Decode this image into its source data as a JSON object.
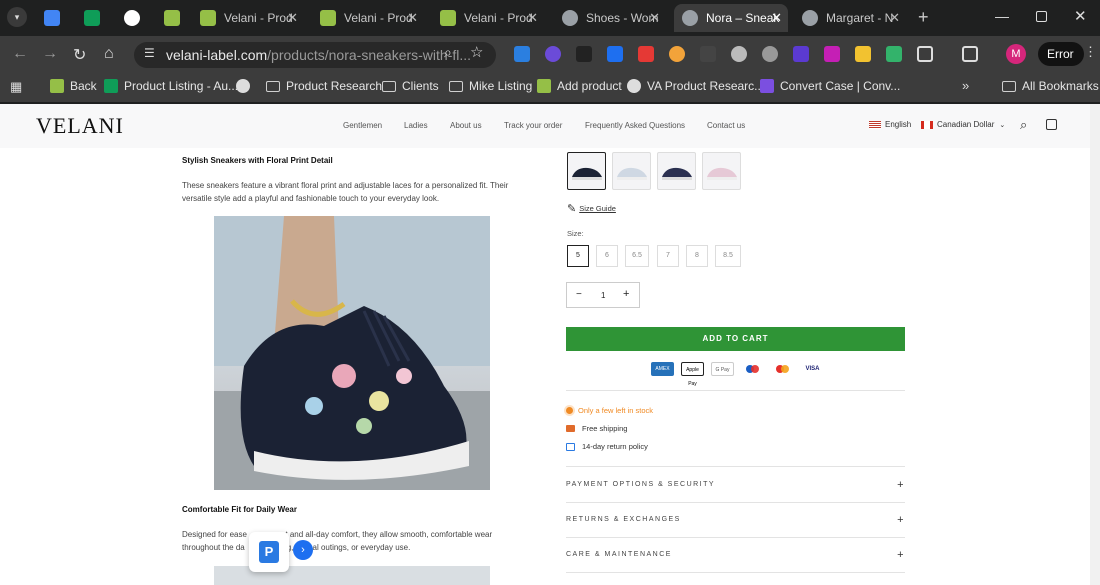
{
  "browser": {
    "tabs": [
      {
        "label": "",
        "icon": "google-docs-icon",
        "color": "#4285f4"
      },
      {
        "label": "",
        "icon": "google-sheets-icon",
        "color": "#0f9d58"
      },
      {
        "label": "",
        "icon": "google-icon",
        "color": "#ffffff"
      },
      {
        "label": "",
        "icon": "shopify-icon",
        "color": "#95bf47"
      },
      {
        "label": "Velani - Prod",
        "icon": "shopify-icon",
        "color": "#95bf47"
      },
      {
        "label": "Velani - Prod",
        "icon": "shopify-icon",
        "color": "#95bf47"
      },
      {
        "label": "Velani - Prod",
        "icon": "shopify-icon",
        "color": "#95bf47"
      },
      {
        "label": "Shoes - Wom",
        "icon": "globe-icon",
        "color": "#9aa0a6"
      },
      {
        "label": "Nora – Sneak",
        "icon": "globe-icon",
        "color": "#9aa0a6"
      },
      {
        "label": "Margaret - N",
        "icon": "globe-icon",
        "color": "#9aa0a6"
      }
    ],
    "url_host": "velani-label.com",
    "url_path": "/products/nora-sneakers-with-fl...",
    "error_label": "Error",
    "profile_initial": "M",
    "bookmarks": [
      "Back",
      "Product Listing - Au...",
      "",
      "Product Research",
      "Clients",
      "Mike Listing",
      "Add product",
      "VA Product Researc...",
      "Convert Case | Conv..."
    ],
    "all_bookmarks": "All Bookmarks"
  },
  "site": {
    "logo": "VELANI",
    "nav": [
      "Gentlemen",
      "Ladies",
      "About us",
      "Track your order",
      "Frequently Asked Questions",
      "Contact us"
    ],
    "language": "English",
    "currency": "Canadian Dollar"
  },
  "description": {
    "heading1": "Stylish Sneakers with Floral Print Detail",
    "para1": "These sneakers feature a vibrant floral print and adjustable laces for a personalized fit. Their versatile style add a playful and fashionable touch to your everyday look.",
    "heading2": "Comfortable Fit for Daily Wear",
    "para2_a": "Designed for ease",
    "para2_b": "nt and all-day comfort, they allow smooth, comfortable wear",
    "para2_c": "throughout the da",
    "para2_d": "g, casual outings, or everyday use."
  },
  "product": {
    "size_guide": "Size Guide",
    "size_label": "Size:",
    "sizes": [
      "5",
      "6",
      "6.5",
      "7",
      "8",
      "8.5"
    ],
    "selected_size": "5",
    "quantity": "1",
    "minus": "−",
    "plus": "+",
    "add_to_cart": "ADD TO CART",
    "payments": [
      "AMEX",
      "Apple Pay",
      "G Pay",
      "Maestro",
      "Mastercard",
      "VISA"
    ],
    "stock": "Only a few left in stock",
    "shipping": "Free shipping",
    "returns": "14-day return policy",
    "accordions": [
      "PAYMENT OPTIONS & SECURITY",
      "RETURNS & EXCHANGES",
      "CARE & MAINTENANCE"
    ],
    "stock_color": "#f08a24",
    "accent_color": "#2f9436"
  }
}
